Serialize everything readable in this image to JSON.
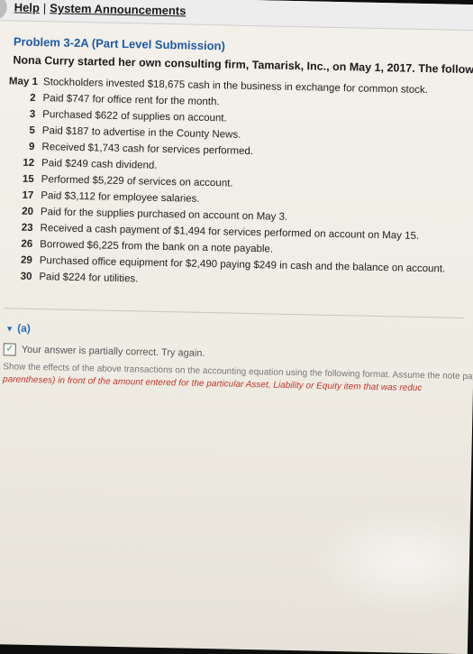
{
  "topbar": {
    "help_label": "Help",
    "separator": "|",
    "announcements_label": "System Announcements"
  },
  "problem": {
    "title": "Problem 3-2A (Part Level Submission)",
    "intro": "Nona Curry started her own consulting firm, Tamarisk, Inc., on May 1, 2017. The following transactions occurred dur",
    "transactions": [
      {
        "date": "May 1",
        "text": "Stockholders invested $18,675 cash in the business in exchange for common stock."
      },
      {
        "date": "2",
        "text": "Paid $747 for office rent for the month."
      },
      {
        "date": "3",
        "text": "Purchased $622 of supplies on account."
      },
      {
        "date": "5",
        "text": "Paid $187 to advertise in the County News."
      },
      {
        "date": "9",
        "text": "Received $1,743 cash for services performed."
      },
      {
        "date": "12",
        "text": "Paid $249 cash dividend."
      },
      {
        "date": "15",
        "text": "Performed $5,229 of services on account."
      },
      {
        "date": "17",
        "text": "Paid $3,112 for employee salaries."
      },
      {
        "date": "20",
        "text": "Paid for the supplies purchased on account on May 3."
      },
      {
        "date": "23",
        "text": "Received a cash payment of $1,494 for services performed on account on May 15."
      },
      {
        "date": "26",
        "text": "Borrowed $6,225 from the bank on a note payable."
      },
      {
        "date": "29",
        "text": "Purchased office equipment for $2,490 paying $249 in cash and the balance on account."
      },
      {
        "date": "30",
        "text": "Paid $224 for utilities."
      }
    ]
  },
  "part_a": {
    "label": "(a)",
    "status": "Your answer is partially correct.  Try again.",
    "instruction_line1": "Show the effects of the above transactions on the accounting equation using the following format. Assume the note pay",
    "instruction_line2": "parentheses) in front of the amount entered for the particular Asset, Liability or Equity item that was reduc"
  }
}
